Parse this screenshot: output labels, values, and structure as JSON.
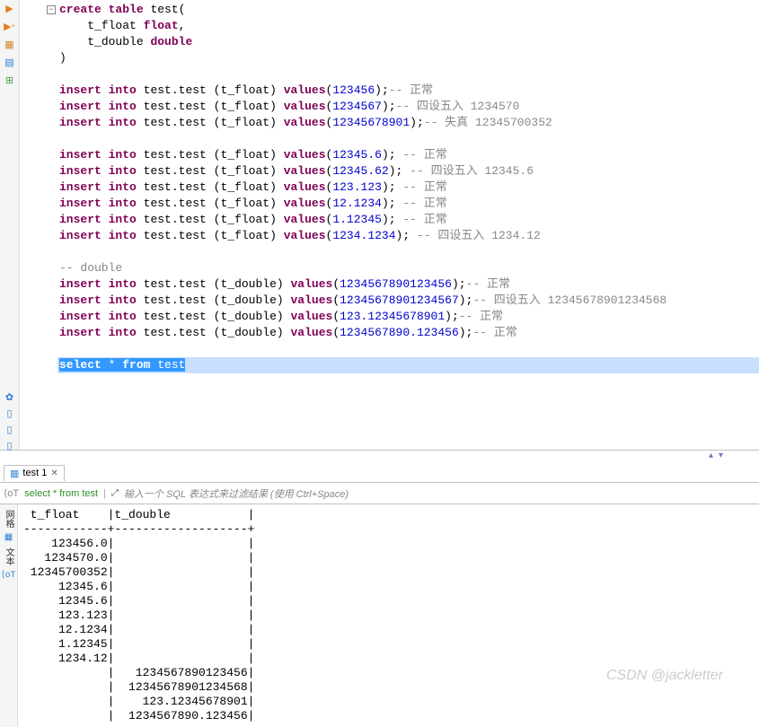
{
  "code": {
    "create_table": "create table",
    "test": "test",
    "t_float_col": "t_float",
    "float_kw": "float",
    "t_double_col": "t_double",
    "double_kw": "double",
    "insert_into": "insert into",
    "test_test": "test.test",
    "t_float_paren": "(t_float)",
    "t_double_paren": "(t_double)",
    "values_kw": "values",
    "comment_normal": "正常",
    "comment_round": "四设五入",
    "comment_distort": "失真",
    "double_comment": "double",
    "vals": {
      "v1": "123456",
      "v2": "1234567",
      "v3": "12345678901",
      "v4": "12345.6",
      "v5": "12345.62",
      "v6": "123.123",
      "v7": "12.1234",
      "v8": "1.12345",
      "v9": "1234.1234",
      "v10": "1234567890123456",
      "v11": "12345678901234567",
      "v12": "123.12345678901",
      "v13": "1234567890.123456"
    },
    "rounded": {
      "r2": "1234570",
      "r3": "12345700352",
      "r5": "12345.6",
      "r9": "1234.12",
      "r11": "12345678901234568"
    },
    "select_stmt": "select * from test"
  },
  "tab": {
    "label": "test 1"
  },
  "query_bar": {
    "text": "select * from test",
    "placeholder": "输入一个 SQL 表达式来过滤结果 (使用 Ctrl+Space)"
  },
  "result": {
    "header": " t_float    |t_double           |",
    "sep": "------------+-------------------+",
    "rows": [
      "    123456.0|                   |",
      "   1234570.0|                   |",
      " 12345700352|                   |",
      "     12345.6|                   |",
      "     12345.6|                   |",
      "     123.123|                   |",
      "     12.1234|                   |",
      "     1.12345|                   |",
      "     1234.12|                   |",
      "            |   1234567890123456|",
      "            |  12345678901234568|",
      "            |    123.12345678901|",
      "            |  1234567890.123456|"
    ]
  },
  "side_labels": {
    "grid": "网格",
    "text": "文本"
  },
  "watermark": "CSDN @jackletter"
}
